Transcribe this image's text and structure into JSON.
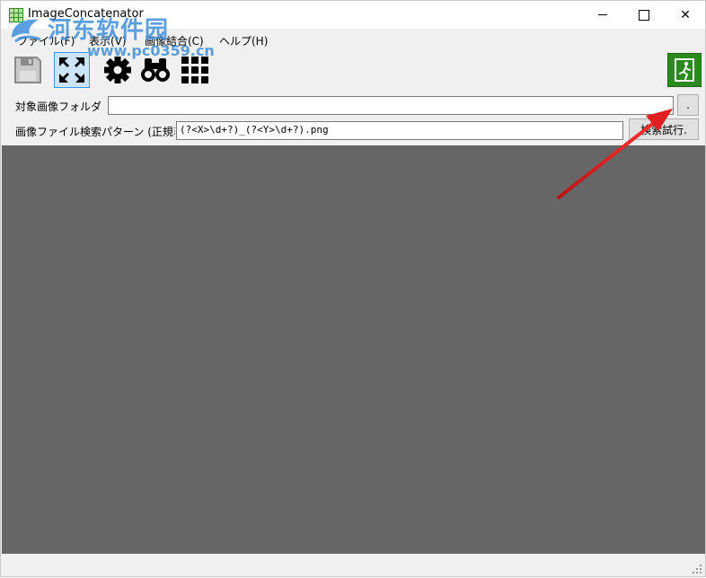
{
  "window": {
    "title": "ImageConcatenator",
    "minimize_glyph": "—",
    "close_glyph": "✕"
  },
  "watermark": {
    "text": "河东软件园",
    "url": "www.pc0359.cn"
  },
  "menu": {
    "items": [
      {
        "label": "ファイル(F)"
      },
      {
        "label": "表示(V)"
      },
      {
        "label": "画像結合(C)"
      },
      {
        "label": "ヘルプ(H)"
      }
    ]
  },
  "toolbar": {
    "icons": [
      "save-icon",
      "fit-screen-icon",
      "settings-gear-icon",
      "binoculars-icon",
      "grid-icon"
    ],
    "exit_icon": "exit-door-icon",
    "exit_color": "#2b8a1d"
  },
  "form": {
    "folder_label": "対象画像フォルダ",
    "folder_value": "",
    "browse_label": ".",
    "pattern_label": "画像ファイル検索パターン (正規表",
    "pattern_value": "(?<X>\\d+?)_(?<Y>\\d+?).png",
    "search_label": "検索試行."
  },
  "colors": {
    "canvas": "#666666",
    "annotation_arrow": "#e02020"
  }
}
